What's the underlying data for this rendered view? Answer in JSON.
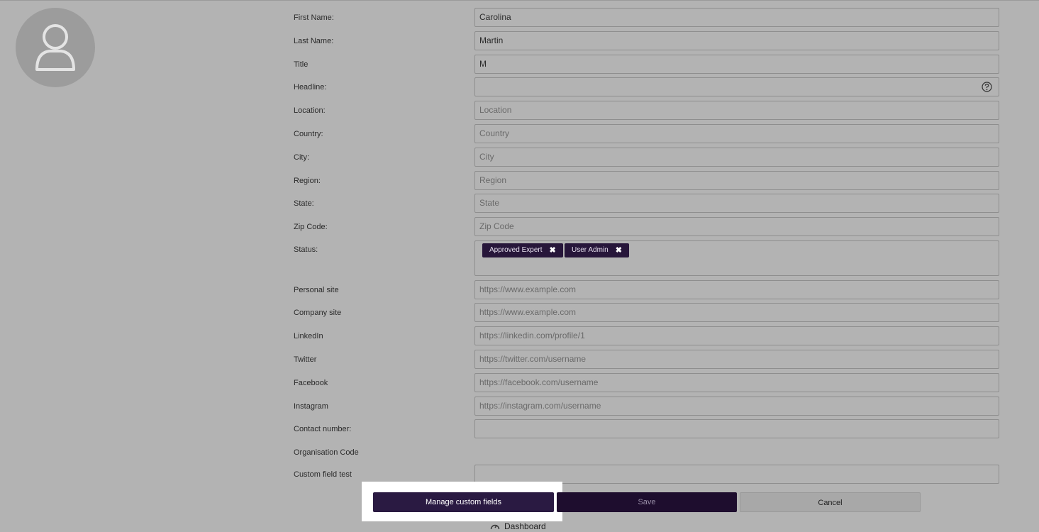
{
  "form": {
    "fields": [
      {
        "label": "First Name:",
        "value": "Carolina",
        "placeholder": ""
      },
      {
        "label": "Last Name:",
        "value": "Martin",
        "placeholder": ""
      },
      {
        "label": "Title",
        "value": "M",
        "placeholder": ""
      },
      {
        "label": "Headline:",
        "value": "",
        "placeholder": ""
      },
      {
        "label": "Location:",
        "value": "",
        "placeholder": "Location"
      },
      {
        "label": "Country:",
        "value": "",
        "placeholder": "Country"
      },
      {
        "label": "City:",
        "value": "",
        "placeholder": "City"
      },
      {
        "label": "Region:",
        "value": "",
        "placeholder": "Region"
      },
      {
        "label": "State:",
        "value": "",
        "placeholder": "State"
      },
      {
        "label": "Zip Code:",
        "value": "",
        "placeholder": "Zip Code"
      }
    ],
    "status_label": "Status:",
    "status_tags": [
      "Approved Expert",
      "User Admin"
    ],
    "fields2": [
      {
        "label": "Personal site",
        "value": "",
        "placeholder": "https://www.example.com"
      },
      {
        "label": "Company site",
        "value": "",
        "placeholder": "https://www.example.com"
      },
      {
        "label": "LinkedIn",
        "value": "",
        "placeholder": "https://linkedin.com/profile/1"
      },
      {
        "label": "Twitter",
        "value": "",
        "placeholder": "https://twitter.com/username"
      },
      {
        "label": "Facebook",
        "value": "",
        "placeholder": "https://facebook.com/username"
      },
      {
        "label": "Instagram",
        "value": "",
        "placeholder": "https://instagram.com/username"
      },
      {
        "label": "Contact number:",
        "value": "",
        "placeholder": ""
      }
    ],
    "org_code_label": "Organisation Code",
    "custom_field_label": "Custom field test",
    "tag_remove_glyph": "✖"
  },
  "buttons": {
    "manage": "Manage custom fields",
    "save": "Save",
    "cancel": "Cancel"
  },
  "nav": {
    "dashboard": "Dashboard"
  },
  "icons": {
    "avatar": "user-avatar-icon",
    "help": "question-circle-icon",
    "dashboard": "dashboard-gauge-icon"
  },
  "colors": {
    "background": "#b3b3b3",
    "primary": "#2a1a42",
    "highlight": "#ffffff"
  }
}
